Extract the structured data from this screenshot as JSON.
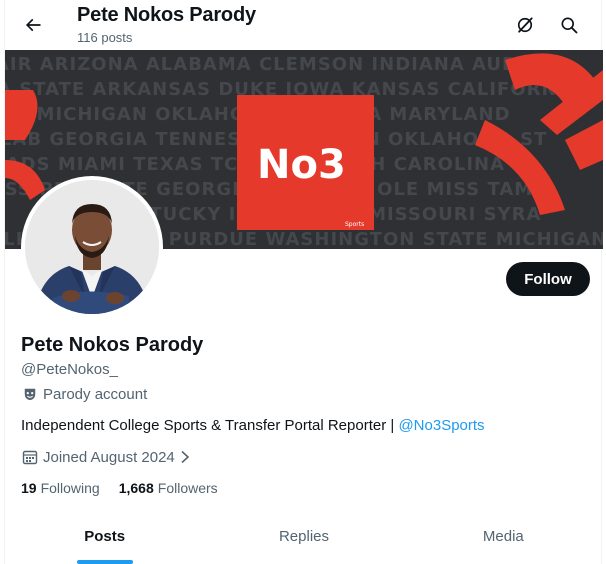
{
  "header": {
    "title": "Pete Nokos Parody",
    "posts_count": "116 posts",
    "back_icon": "arrow-left-icon",
    "grok_icon": "grok-icon",
    "search_icon": "search-icon"
  },
  "banner": {
    "logo_text": "No3",
    "logo_sub": "Sports",
    "school_rows": [
      "AIR ARIZONA ALABAMA CLEMSON INDIANA AUBURN",
      "NA STATE ARKANSAS DUKE IOWA KANSAS CALIFORNIA",
      "OS MICHIGAN OKLAHOMA FLORIDA MARYLAND",
      "ALAB GEORGIA TENNESSEE OREGON OKLAHOMA ST",
      "BADS MIAMI TEXAS TCU LSU NORTH CAROLINA",
      "ISSIPPI STATE GEORGIA TECH USC OLE MISS TAMU",
      "KENTUCKY IOWA STATE MISSOURI SYRA",
      "OLINA VIRGINIA PURDUE WASHINGTON STATE MICHIGAN ST"
    ],
    "colors": {
      "background": "#2f3033",
      "red": "#e53a2b",
      "text": "#44474c"
    }
  },
  "profile": {
    "follow_label": "Follow",
    "display_name": "Pete Nokos Parody",
    "handle": "@PeteNokos_",
    "parody_label": "Parody account",
    "bio_text": "Independent College Sports & Transfer Portal Reporter | ",
    "bio_link": "@No3Sports",
    "joined": "Joined August 2024",
    "following_count": "19",
    "following_label": "Following",
    "followers_count": "1,668",
    "followers_label": "Followers"
  },
  "tabs": [
    {
      "label": "Posts",
      "active": true
    },
    {
      "label": "Replies",
      "active": false
    },
    {
      "label": "Media",
      "active": false
    }
  ],
  "colors": {
    "accent": "#1d9bf0",
    "text": "#0f1419",
    "muted": "#536471"
  }
}
